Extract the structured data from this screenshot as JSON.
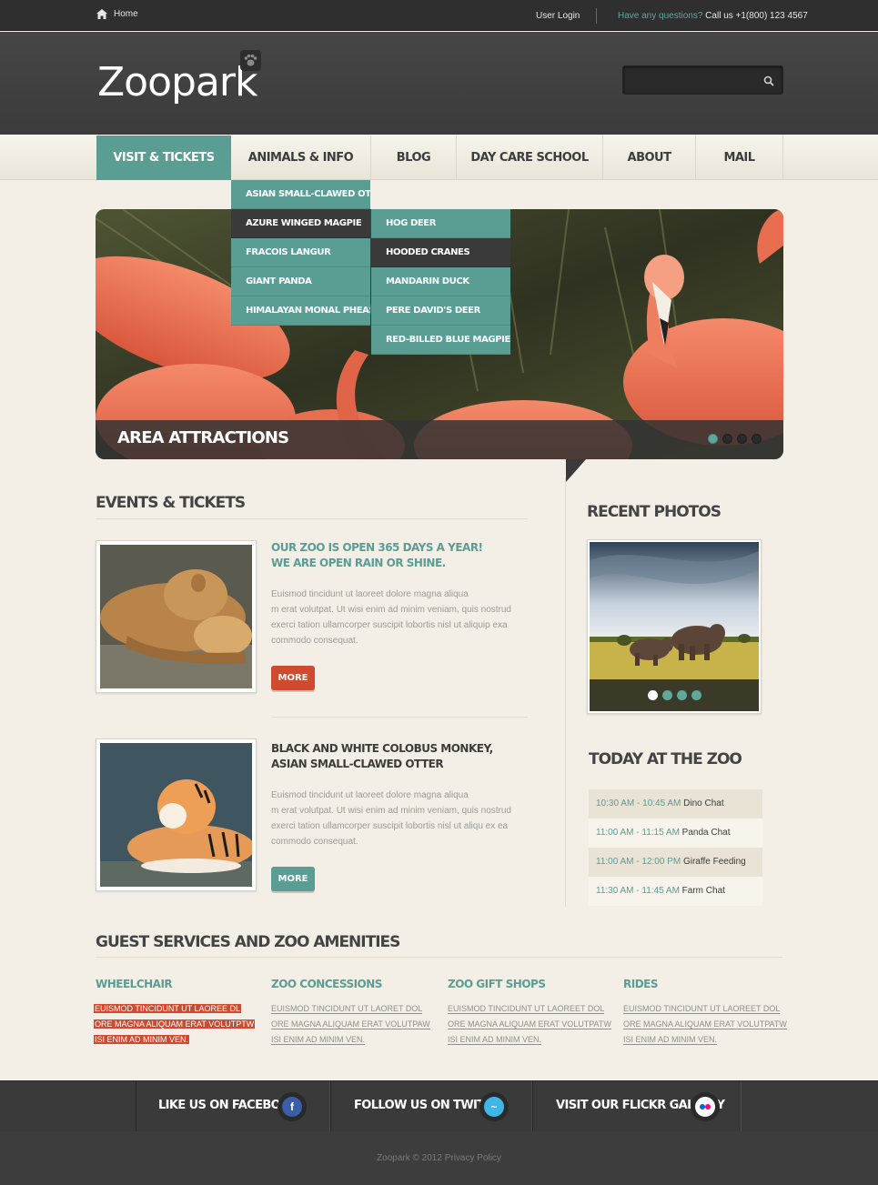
{
  "topbar": {
    "home": "Home",
    "user_login": "User Login",
    "question": "Have any questions?",
    "phone": " Call us +1(800) 123 4567"
  },
  "header": {
    "logo": "Zoopark",
    "search_placeholder": ""
  },
  "nav": [
    {
      "label": "VISIT & TICKETS",
      "active": true
    },
    {
      "label": "ANIMALS & INFO"
    },
    {
      "label": "BLOG"
    },
    {
      "label": "DAY CARE SCHOOL"
    },
    {
      "label": "ABOUT"
    },
    {
      "label": "MAIL"
    }
  ],
  "dropdown": {
    "level1": [
      "ASIAN SMALL-CLAWED OTTER",
      "AZURE WINGED MAGPIE",
      "FRACOIS LANGUR",
      "GIANT PANDA",
      "HIMALAYAN MONAL PHEASANT"
    ],
    "level2": [
      "HOG DEER",
      "HOODED CRANES",
      "MANDARIN DUCK",
      "PERE DAVID'S DEER",
      "RED-BILLED BLUE MAGPIE"
    ]
  },
  "slider": {
    "caption": "AREA ATTRACTIONS",
    "dots": 4,
    "active_dot": 1
  },
  "events": {
    "heading": "EVENTS & TICKETS",
    "items": [
      {
        "title1": "OUR ZOO IS OPEN 365 DAYS A YEAR!",
        "title2": "WE ARE OPEN RAIN OR SHINE.",
        "text1": "Euismod tincidunt ut laoreet dolore magna aliqua",
        "text2": "m erat volutpat. Ut wisi enim ad minim veniam, quis nostrud",
        "text3": "exerci tation ullamcorper suscipit lobortis nisl ut aliquip exa",
        "text4": "commodo consequat.",
        "more": "MORE"
      },
      {
        "title1": "BLACK AND WHITE COLOBUS MONKEY,",
        "title2": "ASIAN SMALL-CLAWED OTTER",
        "text1": "Euismod tincidunt ut laoreet dolore magna aliqua",
        "text2": "m erat volutpat. Ut wisi enim ad minim veniam, quis nostrud",
        "text3": "exerci tation ullamcorper suscipit lobortis nisl ut aliqu ex ea",
        "text4": "commodo consequat.",
        "more": "MORE"
      }
    ]
  },
  "photos": {
    "heading": "RECENT PHOTOS",
    "dots": 4,
    "active_dot": 1
  },
  "today": {
    "heading": "TODAY AT THE ZOO",
    "items": [
      {
        "time": "10:30 AM - 10:45 AM",
        "event": " Dino Chat"
      },
      {
        "time": "11:00 AM - 11:15 AM",
        "event": "  Panda Chat"
      },
      {
        "time": "11:00 AM - 12:00 PM",
        "event": " Giraffe Feeding"
      },
      {
        "time": "11:30 AM - 11:45 AM",
        "event": "  Farm Chat"
      }
    ]
  },
  "amenities": {
    "heading": "GUEST SERVICES AND ZOO AMENITIES",
    "items": [
      {
        "title": "WHEELCHAIR",
        "l1": "EUISMOD TINCIDUNT UT LAOREE DL",
        "l2": "ORE MAGNA ALIQUAM ERAT VOLUTPTW",
        "l3": "ISI ENIM AD MINIM VEN."
      },
      {
        "title": "ZOO CONCESSIONS",
        "l1": "EUISMOD TINCIDUNT UT LAORET DOL",
        "l2": "ORE MAGNA ALIQUAM ERAT VOLUTPAW",
        "l3": "ISI ENIM AD MINIM VEN."
      },
      {
        "title": "ZOO GIFT SHOPS",
        "l1": "EUISMOD TINCIDUNT UT LAOREET DOL",
        "l2": "ORE MAGNA ALIQUAM ERAT VOLUTPATW",
        "l3": "ISI ENIM AD MINIM VEN."
      },
      {
        "title": "RIDES",
        "l1": "EUISMOD TINCIDUNT UT LAOREET DOL",
        "l2": "ORE MAGNA ALIQUAM ERAT VOLUTPATW",
        "l3": "ISI ENIM AD MINIM VEN."
      }
    ]
  },
  "social": {
    "facebook": "LIKE US ON FACEBOOK",
    "twitter": "FOLLOW US ON TWITTER",
    "flickr": "VISIT OUR FLICKR GALLERY",
    "facebook_icon": "facebook-icon",
    "twitter_icon": "twitter-icon",
    "flickr_icon": "flickr-icon"
  },
  "footer": {
    "copyright": "Zoopark © 2012 Privacy Policy"
  },
  "colors": {
    "accent": "#5a9d92",
    "button_red": "#cf4a2e",
    "dark": "#3a3a3a",
    "background": "#f3efe6"
  }
}
